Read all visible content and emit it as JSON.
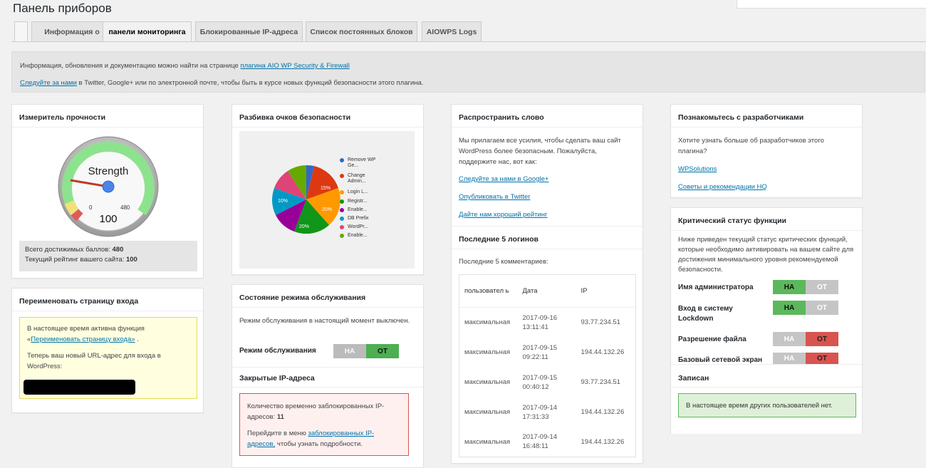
{
  "page_title": "Панель приборов",
  "tabs": [
    "Информация о",
    "панели мониторинга",
    "Блокированные IP-адреса",
    "Список постоянных блоков",
    "AIOWPS Logs"
  ],
  "info": {
    "line1_prefix": "Информация, обновления и документацию можно найти на странице",
    "line1_link": "плагина AIO WP Security & Firewall",
    "line2_link": "Следуйте за нами",
    "line2_suffix": "в Twitter, Google+ или по электронной почте, чтобы быть в курсе новых функций безопасности этого плагина."
  },
  "strength": {
    "title": "Измеритель прочности",
    "gauge_label": "Strength",
    "gauge_value": "100",
    "min": "0",
    "max": "480",
    "max_points_label": "Всего достижимых баллов:",
    "max_points": "480",
    "current_label": "Текущий рейтинг вашего сайта:",
    "current": "100"
  },
  "rename_login": {
    "title": "Переименовать страницу входа",
    "text1": "В настоящее время активна функция «",
    "link": "Переименовать страницу входа»",
    "text1_end": ".",
    "text2": "Теперь ваш новый URL-адрес для входа в WordPress:"
  },
  "breakdown": {
    "title": "Разбивка очков безопасности",
    "legend": [
      "Remove WP Ge...",
      "Change Admin...",
      "Login L...",
      "Registr...",
      "Enable...",
      "DB Prefix",
      "WordPr...",
      "Enable..."
    ],
    "labels": [
      "15%",
      "20%",
      "20%",
      "10%"
    ]
  },
  "maintenance": {
    "title": "Состояние режима обслуживания",
    "text": "Режим обслуживания в настоящий момент выключен.",
    "label": "Режим обслуживания",
    "on": "НА",
    "off": "ОТ"
  },
  "locked_ips": {
    "title": "Закрытые IP-адреса",
    "text1": "Количество временно заблокированных IP-адресов:",
    "count": "11",
    "text2": "Перейдите в меню",
    "link": "заблокированных IP-адресов,",
    "text3": "чтобы узнать подробности."
  },
  "spread": {
    "title": "Распространить слово",
    "text": "Мы прилагаем все усилия, чтобы сделать ваш сайт WordPress более безопасным. Пожалуйста, поддержите нас, вот как:",
    "links": [
      "Следуйте за нами в Google+",
      "Опубликовать в Twitter",
      "Дайте нам хороший рейтинг"
    ]
  },
  "logins": {
    "title": "Последние 5 логинов",
    "subtitle": "Последние 5 комментариев:",
    "headers": [
      "пользовател ь",
      "Дата",
      "IP"
    ],
    "rows": [
      [
        "максимальная",
        "2017-09-16 13:11:41",
        "93.77.234.51"
      ],
      [
        "максимальная",
        "2017-09-15 09:22:11",
        "194.44.132.26"
      ],
      [
        "максимальная",
        "2017-09-15 00:40:12",
        "93.77.234.51"
      ],
      [
        "максимальная",
        "2017-09-14 17:31:33",
        "194.44.132.26"
      ],
      [
        "максимальная",
        "2017-09-14 16:48:11",
        "194.44.132.26"
      ]
    ]
  },
  "developers": {
    "title": "Познакомьтесь с разработчиками",
    "text": "Хотите узнать больше об разработчиков этого плагина?",
    "links": [
      "WPSolutions",
      "Советы и рекомендации HQ"
    ]
  },
  "critical": {
    "title": "Критический статус функции",
    "text": "Ниже приведен текущий статус критических функций, которые необходимо активировать на вашем сайте для достижения минимального уровня рекомендуемой безопасности.",
    "items": [
      {
        "label": "Имя администратора",
        "state": "on"
      },
      {
        "label": "Вход в систему Lockdown",
        "state": "on"
      },
      {
        "label": "Разрешение файла",
        "state": "off"
      },
      {
        "label": "Базовый сетевой экран",
        "state": "off"
      }
    ],
    "on": "НА",
    "off": "ОТ"
  },
  "logged_in": {
    "title": "Записан",
    "text": "В настоящее время других пользователей нет."
  }
}
